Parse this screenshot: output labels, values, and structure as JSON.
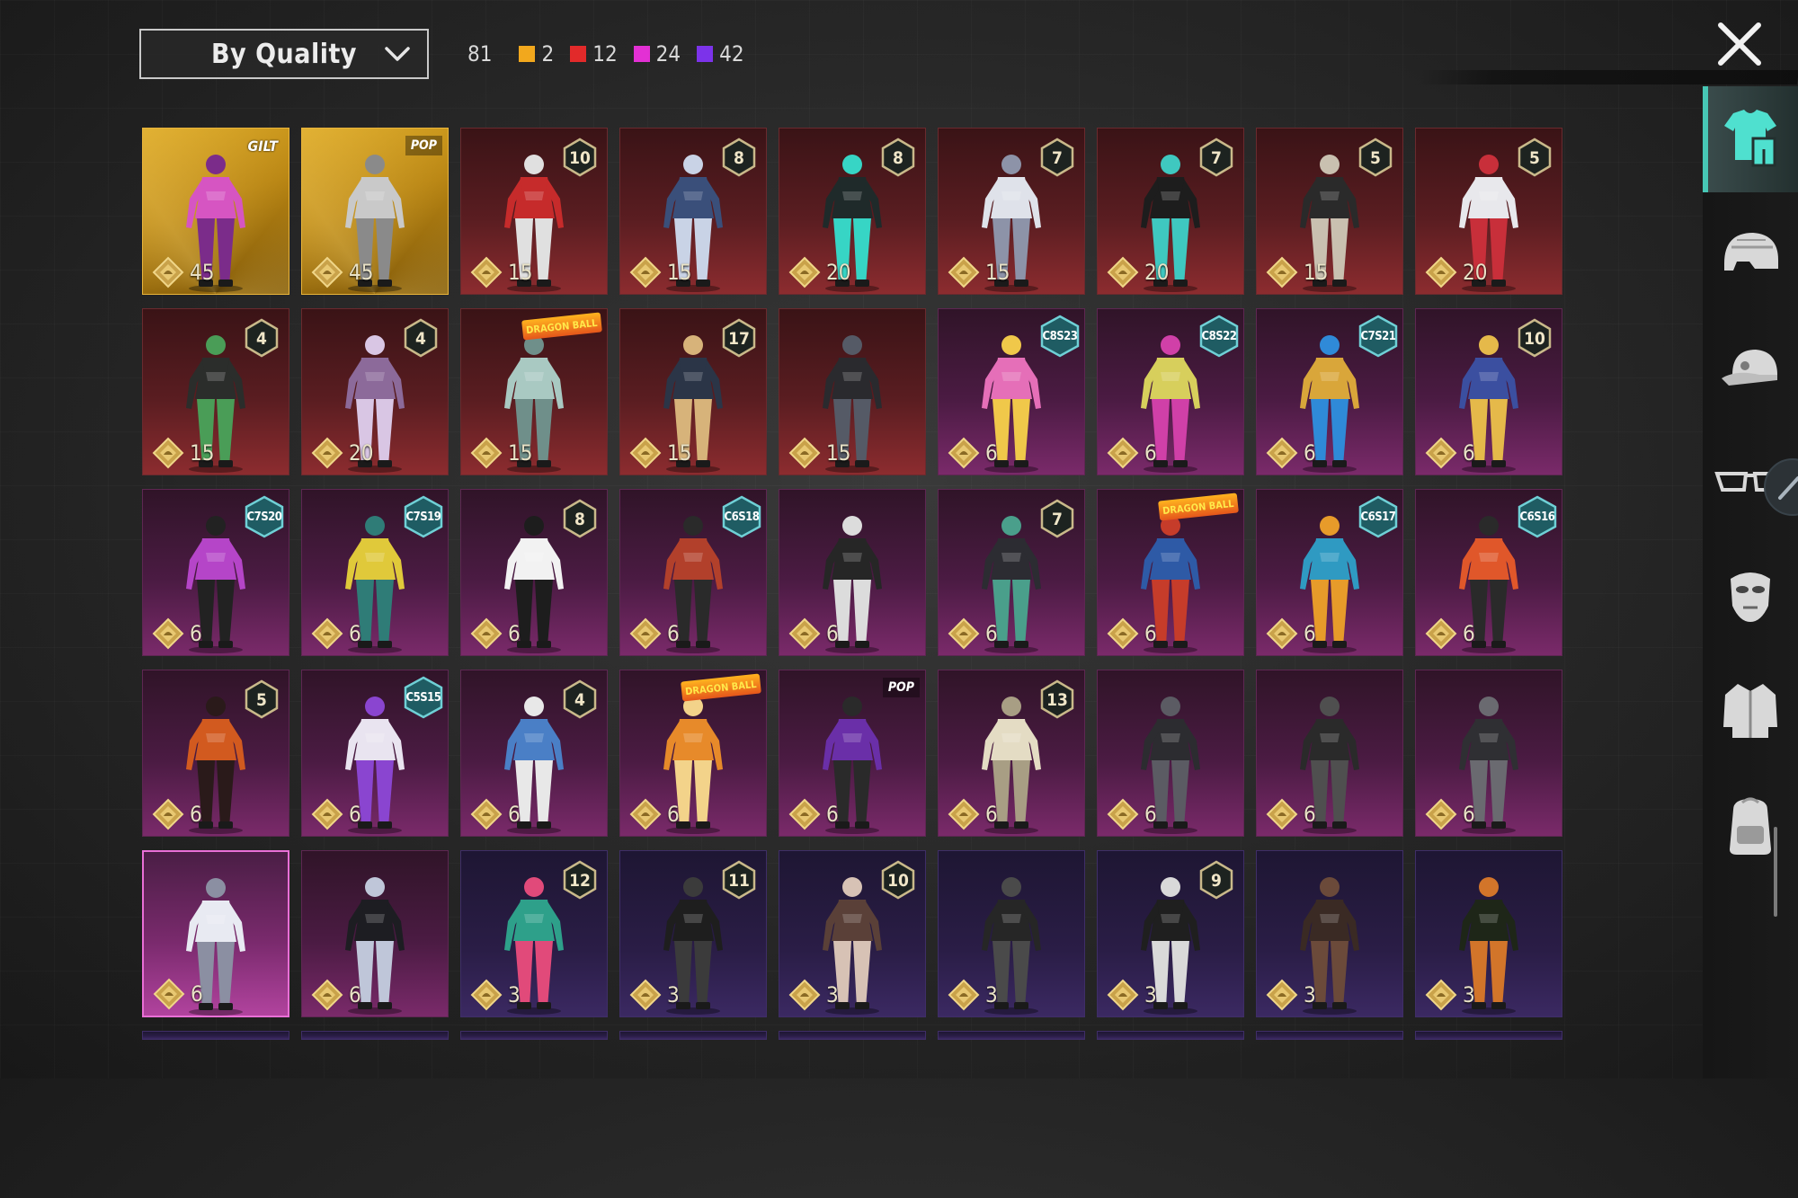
{
  "header": {
    "sort_label": "By Quality",
    "total_count": "81",
    "quality_counts": [
      {
        "label": "2",
        "color": "#f2a81d"
      },
      {
        "label": "12",
        "color": "#e22a2a"
      },
      {
        "label": "24",
        "color": "#e330d4"
      },
      {
        "label": "42",
        "color": "#7c33ea"
      }
    ]
  },
  "categories": [
    {
      "name": "outfit",
      "icon": "outfit-icon",
      "active": true
    },
    {
      "name": "helmet",
      "icon": "helmet-icon",
      "active": false
    },
    {
      "name": "hat",
      "icon": "cap-icon",
      "active": false
    },
    {
      "name": "eyewear",
      "icon": "glasses-icon",
      "active": false
    },
    {
      "name": "mask",
      "icon": "mask-icon",
      "active": false
    },
    {
      "name": "jacket",
      "icon": "jacket-icon",
      "active": false
    },
    {
      "name": "backpack",
      "icon": "backpack-icon",
      "active": false
    }
  ],
  "items": [
    {
      "quality": "gold",
      "cost": "45",
      "tag": "GILT",
      "tag_type": "gilt",
      "colors": [
        "#d655c2",
        "#7b2c8a"
      ]
    },
    {
      "quality": "gold",
      "cost": "45",
      "tag": "POP",
      "tag_type": "pop",
      "colors": [
        "#c9c9c9",
        "#8a8a8a"
      ]
    },
    {
      "quality": "red",
      "cost": "15",
      "level": "10",
      "colors": [
        "#c62b2b",
        "#e0e0e0"
      ]
    },
    {
      "quality": "red",
      "cost": "15",
      "level": "8",
      "colors": [
        "#3a4f7a",
        "#c9d3e6"
      ]
    },
    {
      "quality": "red",
      "cost": "20",
      "level": "8",
      "colors": [
        "#1f2a2a",
        "#37d5c5"
      ]
    },
    {
      "quality": "red",
      "cost": "15",
      "level": "7",
      "colors": [
        "#dfe2ea",
        "#8d93a8"
      ]
    },
    {
      "quality": "red",
      "cost": "20",
      "level": "7",
      "colors": [
        "#1d1d1d",
        "#3fc8c0"
      ]
    },
    {
      "quality": "red",
      "cost": "15",
      "level": "5",
      "colors": [
        "#2a2a2a",
        "#c9c0b0"
      ]
    },
    {
      "quality": "red",
      "cost": "20",
      "level": "5",
      "colors": [
        "#e8e8ec",
        "#c82f3a"
      ]
    },
    {
      "quality": "red",
      "cost": "15",
      "level": "4",
      "colors": [
        "#2b2d2b",
        "#4a9d57"
      ]
    },
    {
      "quality": "red",
      "cost": "20",
      "level": "4",
      "colors": [
        "#8c6a9a",
        "#d9c6e4"
      ]
    },
    {
      "quality": "red",
      "cost": "15",
      "tag": "DRAGON BALL",
      "tag_type": "dbz",
      "colors": [
        "#a9c9c2",
        "#6f8f8a"
      ]
    },
    {
      "quality": "red",
      "cost": "15",
      "level": "17",
      "colors": [
        "#2b3547",
        "#d7b37a"
      ]
    },
    {
      "quality": "red",
      "cost": "15",
      "colors": [
        "#2a2a2e",
        "#555a66"
      ]
    },
    {
      "quality": "pink",
      "cost": "6",
      "season": "C8S23",
      "colors": [
        "#e56fb8",
        "#f0c84a"
      ]
    },
    {
      "quality": "pink",
      "cost": "6",
      "season": "C8S22",
      "colors": [
        "#d7cf5c",
        "#d040a8"
      ]
    },
    {
      "quality": "pink",
      "cost": "6",
      "season": "C7S21",
      "colors": [
        "#d9a63a",
        "#2f8ad8"
      ]
    },
    {
      "quality": "pink",
      "cost": "6",
      "level": "10",
      "colors": [
        "#3b4fa0",
        "#e5b94a"
      ]
    },
    {
      "quality": "pink",
      "cost": "6",
      "season": "C7S20",
      "colors": [
        "#b545c8",
        "#222222"
      ]
    },
    {
      "quality": "pink",
      "cost": "6",
      "season": "C7S19",
      "colors": [
        "#e0c93a",
        "#2f7c77"
      ]
    },
    {
      "quality": "pink",
      "cost": "6",
      "level": "8",
      "colors": [
        "#f2f2f2",
        "#1d1d1d"
      ]
    },
    {
      "quality": "pink",
      "cost": "6",
      "season": "C6S18",
      "colors": [
        "#b2402b",
        "#2a2a2a"
      ]
    },
    {
      "quality": "pink",
      "cost": "6",
      "colors": [
        "#262626",
        "#dcdcdc"
      ]
    },
    {
      "quality": "pink",
      "cost": "6",
      "level": "7",
      "colors": [
        "#2c2c32",
        "#4a9f8b"
      ]
    },
    {
      "quality": "pink",
      "cost": "6",
      "tag": "DRAGON BALL",
      "tag_type": "dbz",
      "colors": [
        "#2e5aa6",
        "#c63c2a"
      ]
    },
    {
      "quality": "pink",
      "cost": "6",
      "season": "C6S17",
      "colors": [
        "#2f9ac2",
        "#e79b2a"
      ]
    },
    {
      "quality": "pink",
      "cost": "6",
      "season": "C6S16",
      "colors": [
        "#e0572a",
        "#2a2a2a"
      ]
    },
    {
      "quality": "pink",
      "cost": "6",
      "level": "5",
      "colors": [
        "#d25a1f",
        "#2a1a1a"
      ]
    },
    {
      "quality": "pink",
      "cost": "6",
      "season": "C5S15",
      "colors": [
        "#e9e4f0",
        "#8a45d0"
      ]
    },
    {
      "quality": "pink",
      "cost": "6",
      "level": "4",
      "colors": [
        "#4a7fc6",
        "#e8e8e8"
      ]
    },
    {
      "quality": "pink",
      "cost": "6",
      "tag": "DRAGON BALL",
      "tag_type": "dbz",
      "colors": [
        "#e78a2a",
        "#f3d38a"
      ]
    },
    {
      "quality": "pink",
      "cost": "6",
      "tag": "POP",
      "tag_type": "pop",
      "colors": [
        "#6a2fa8",
        "#2a2a2a"
      ]
    },
    {
      "quality": "pink",
      "cost": "6",
      "level": "13",
      "colors": [
        "#e4dcc4",
        "#a89e84"
      ]
    },
    {
      "quality": "pink",
      "cost": "6",
      "colors": [
        "#2c2c30",
        "#5b5b63"
      ]
    },
    {
      "quality": "pink",
      "cost": "6",
      "colors": [
        "#2a2a2a",
        "#4f4f4f"
      ]
    },
    {
      "quality": "pink",
      "cost": "6",
      "colors": [
        "#2f2f33",
        "#6a6a70"
      ]
    },
    {
      "quality": "pink-hi",
      "cost": "6",
      "colors": [
        "#e8eaf2",
        "#8b8fa2"
      ]
    },
    {
      "quality": "pink",
      "cost": "6",
      "colors": [
        "#1d1d22",
        "#bfc6d9"
      ]
    },
    {
      "quality": "purple",
      "cost": "3",
      "level": "12",
      "colors": [
        "#2ea08a",
        "#e14a7a"
      ]
    },
    {
      "quality": "purple",
      "cost": "3",
      "level": "11",
      "colors": [
        "#1e1e1e",
        "#3b3b3b"
      ]
    },
    {
      "quality": "purple",
      "cost": "3",
      "level": "10",
      "colors": [
        "#5a4038",
        "#d7c2b5"
      ]
    },
    {
      "quality": "purple",
      "cost": "3",
      "colors": [
        "#262626",
        "#4a4a4a"
      ]
    },
    {
      "quality": "purple",
      "cost": "3",
      "level": "9",
      "colors": [
        "#1f1f1f",
        "#d9d9d9"
      ]
    },
    {
      "quality": "purple",
      "cost": "3",
      "colors": [
        "#3a2a24",
        "#6b4a3a"
      ]
    },
    {
      "quality": "purple",
      "cost": "3",
      "colors": [
        "#1e2618",
        "#d2752a"
      ]
    }
  ],
  "partial_row_count": 9
}
